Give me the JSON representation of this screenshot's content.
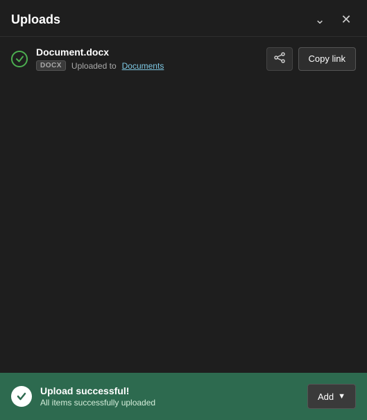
{
  "header": {
    "title": "Uploads",
    "minimize_label": "minimize",
    "close_label": "close"
  },
  "upload_item": {
    "file_name": "Document.docx",
    "file_type": "DOCX",
    "uploaded_to_label": "Uploaded to",
    "location_link": "Documents",
    "copy_link_label": "Copy link"
  },
  "banner": {
    "title": "Upload successful!",
    "subtitle": "All items successfully uploaded",
    "add_label": "Add"
  }
}
